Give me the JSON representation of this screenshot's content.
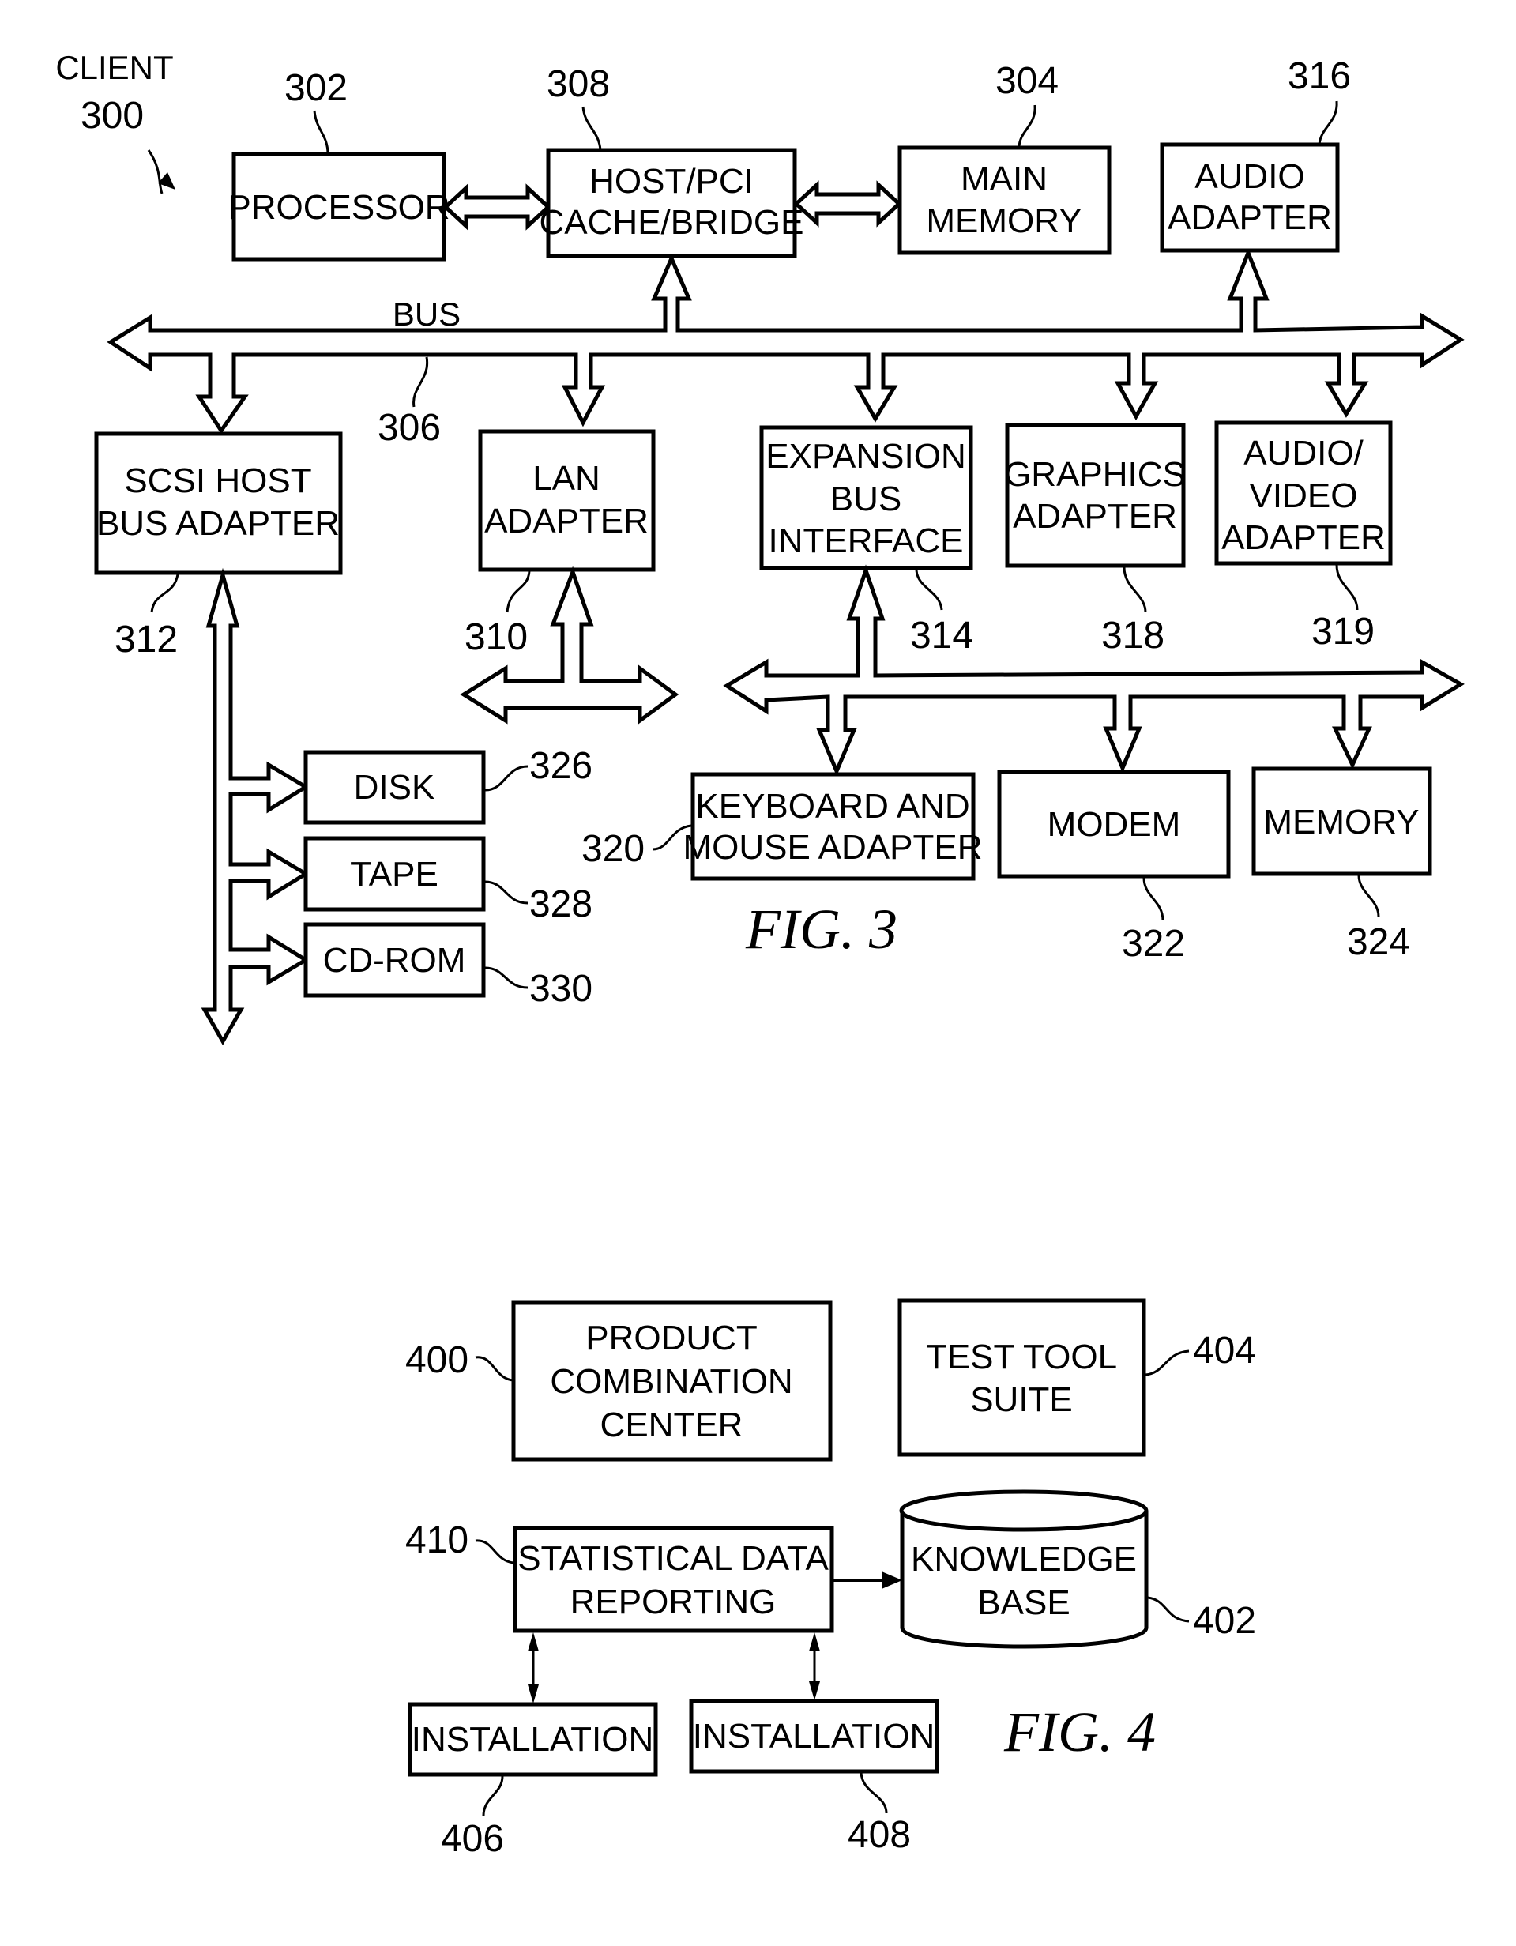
{
  "figure3": {
    "caption": "FIG. 3",
    "client_label": "CLIENT",
    "client_ref": "300",
    "bus_label": "BUS",
    "bus_ref": "306",
    "blocks": {
      "processor": {
        "lines": [
          "PROCESSOR"
        ],
        "ref": "302"
      },
      "host_pci": {
        "lines": [
          "HOST/PCI",
          "CACHE/BRIDGE"
        ],
        "ref": "308"
      },
      "main_memory": {
        "lines": [
          "MAIN",
          "MEMORY"
        ],
        "ref": "304"
      },
      "audio_adapter": {
        "lines": [
          "AUDIO",
          "ADAPTER"
        ],
        "ref": "316"
      },
      "scsi": {
        "lines": [
          "SCSI HOST",
          "BUS ADAPTER"
        ],
        "ref": "312"
      },
      "lan": {
        "lines": [
          "LAN",
          "ADAPTER"
        ],
        "ref": "310"
      },
      "expansion": {
        "lines": [
          "EXPANSION",
          "BUS",
          "INTERFACE"
        ],
        "ref": "314"
      },
      "graphics": {
        "lines": [
          "GRAPHICS",
          "ADAPTER"
        ],
        "ref": "318"
      },
      "av_adapter": {
        "lines": [
          "AUDIO/",
          "VIDEO",
          "ADAPTER"
        ],
        "ref": "319"
      },
      "keyboard": {
        "lines": [
          "KEYBOARD AND",
          "MOUSE ADAPTER"
        ],
        "ref": "320"
      },
      "modem": {
        "lines": [
          "MODEM"
        ],
        "ref": "322"
      },
      "memory": {
        "lines": [
          "MEMORY"
        ],
        "ref": "324"
      },
      "disk": {
        "lines": [
          "DISK"
        ],
        "ref": "326"
      },
      "tape": {
        "lines": [
          "TAPE"
        ],
        "ref": "328"
      },
      "cdrom": {
        "lines": [
          "CD-ROM"
        ],
        "ref": "330"
      }
    }
  },
  "figure4": {
    "caption": "FIG. 4",
    "blocks": {
      "product_combination_center": {
        "lines": [
          "PRODUCT",
          "COMBINATION",
          "CENTER"
        ],
        "ref": "400"
      },
      "test_tool_suite": {
        "lines": [
          "TEST TOOL",
          "SUITE"
        ],
        "ref": "404"
      },
      "statistical_data_reporting": {
        "lines": [
          "STATISTICAL DATA",
          "REPORTING"
        ],
        "ref": "410"
      },
      "knowledge_base": {
        "lines": [
          "KNOWLEDGE",
          "BASE"
        ],
        "ref": "402"
      },
      "installation_1": {
        "lines": [
          "INSTALLATION"
        ],
        "ref": "406"
      },
      "installation_2": {
        "lines": [
          "INSTALLATION"
        ],
        "ref": "408"
      }
    }
  }
}
